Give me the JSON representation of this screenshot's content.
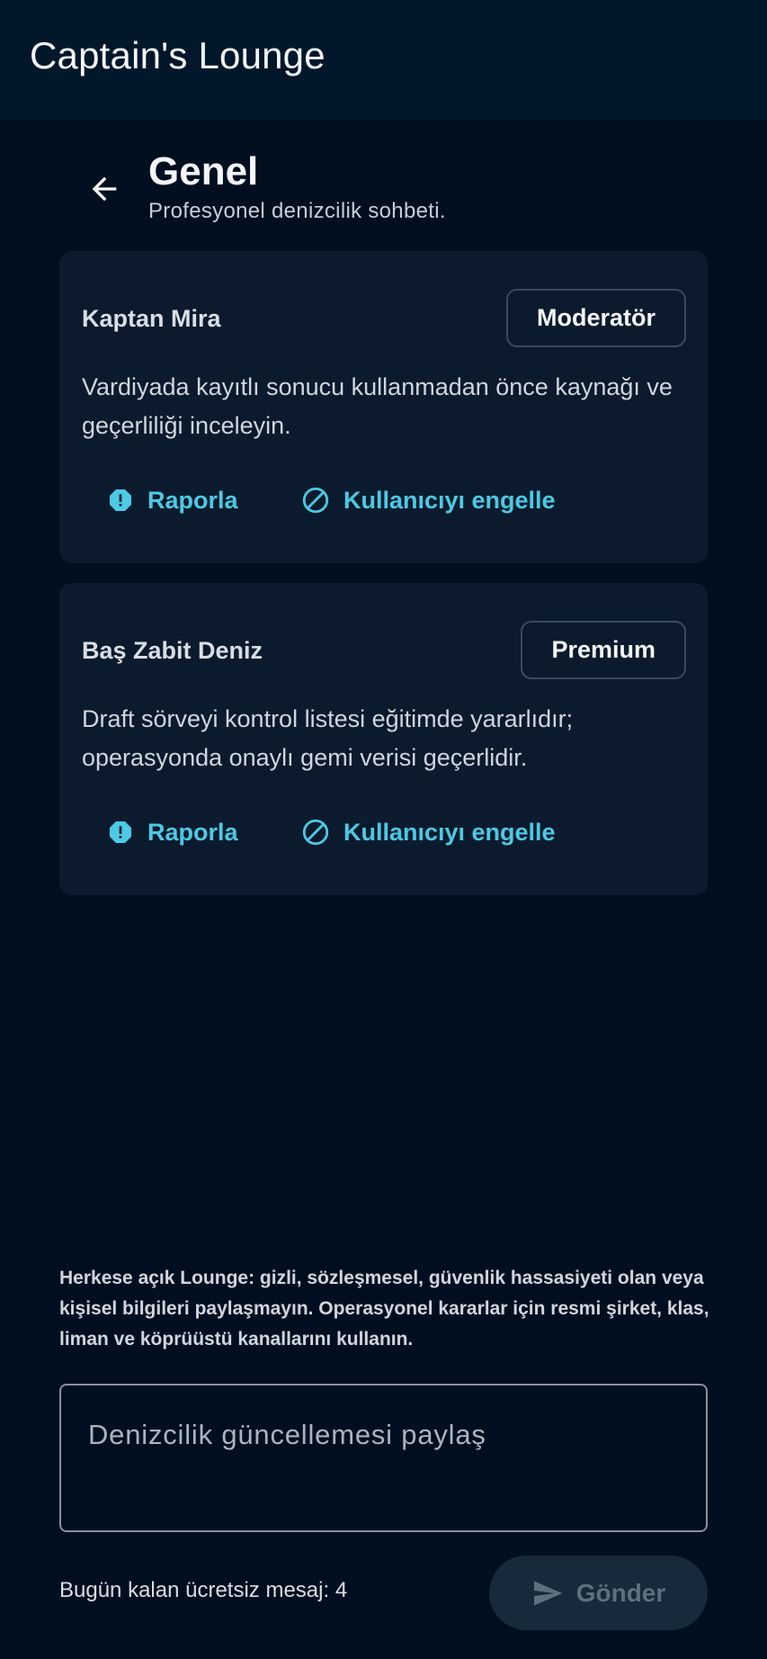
{
  "app": {
    "title": "Captain's Lounge"
  },
  "channel": {
    "title": "Genel",
    "subtitle": "Profesyonel denizcilik sohbeti."
  },
  "posts": [
    {
      "author": "Kaptan Mira",
      "badge": "Moderatör",
      "message": "Vardiyada kayıtlı sonucu kullanmadan önce kaynağı ve geçerliliği inceleyin.",
      "report_label": "Raporla",
      "block_label": "Kullanıcıyı engelle"
    },
    {
      "author": "Baş Zabit Deniz",
      "badge": "Premium",
      "message": "Draft sörveyi kontrol listesi eğitimde yararlıdır; operasyonda onaylı gemi verisi geçerlidir.",
      "report_label": "Raporla",
      "block_label": "Kullanıcıyı engelle"
    }
  ],
  "notice": "Herkese açık Lounge: gizli, sözleşmesel, güvenlik hassasiyeti olan veya kişisel bilgileri paylaşmayın. Operasyonel kararlar için resmi şirket, klas, liman ve köprüüstü kanallarını kullanın.",
  "composer": {
    "placeholder": "Denizcilik güncellemesi paylaş",
    "value": "",
    "remaining": "Bugün kalan ücretsiz mesaj: 4",
    "send_label": "Gönder"
  },
  "icons": {
    "back": "arrow-back-icon",
    "report": "report-icon",
    "block": "block-icon",
    "send": "send-icon"
  },
  "colors": {
    "background": "#000f1f",
    "appbar": "#03172b",
    "card": "#0b1b2d",
    "accent": "#4cc9e4",
    "send_disabled_bg": "#18293b",
    "send_disabled_text": "#5f6f80"
  }
}
